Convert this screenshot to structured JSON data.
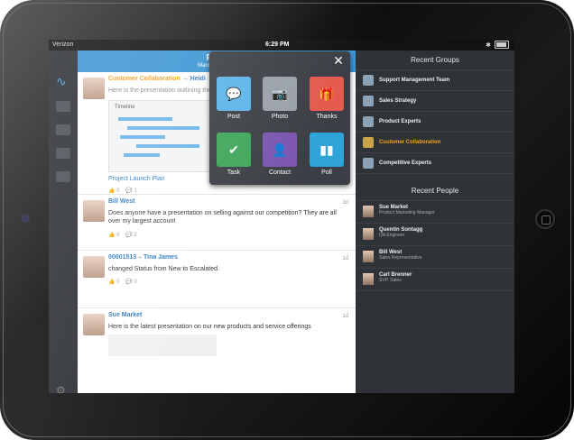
{
  "status_bar": {
    "carrier": "Verizon",
    "time": "6:29 PM"
  },
  "feed": {
    "title": "Feed",
    "date": "March 13, 2013",
    "posts": [
      {
        "author": "Customer Collaboration",
        "arrow": "→",
        "author2": "Heidi",
        "text": "Here is the presentation outlining the...",
        "attachment_title": "Timeline",
        "attachment_link": "Project Launch Plan",
        "likes": "0",
        "comments": "1"
      },
      {
        "author": "Bill West",
        "age": "1d",
        "text": "Does anyone have a presentation on selling against our competition? They are all over my largest account",
        "likes": "0",
        "comments": "2"
      },
      {
        "author": "00001513",
        "arrow": "–",
        "author2": "Tina James",
        "age": "1d",
        "text": "changed Status from New to Escalated.",
        "likes": "0",
        "comments": "0"
      },
      {
        "author": "Sue Market",
        "age": "1d",
        "text": "Here is the latest presentation on our new products and service offerings"
      }
    ]
  },
  "popup": {
    "close": "✕",
    "actions": [
      {
        "label": "Post",
        "icon": "💬",
        "color": "#5cb4e8"
      },
      {
        "label": "Photo",
        "icon": "📷",
        "color": "#9aa0a8"
      },
      {
        "label": "Thanks",
        "icon": "🎁",
        "color": "#e45a4e"
      },
      {
        "label": "Task",
        "icon": "✔",
        "color": "#3fa65a"
      },
      {
        "label": "Contact",
        "icon": "👤",
        "color": "#7b55b0"
      },
      {
        "label": "Poll",
        "icon": "▮▮",
        "color": "#2fa3d8"
      }
    ]
  },
  "recent_groups": {
    "header": "Recent Groups",
    "items": [
      "Support Management Team",
      "Sales Strategy",
      "Product Experts",
      "Customer Collaboration",
      "Competitive Experts"
    ]
  },
  "recent_people": {
    "header": "Recent People",
    "items": [
      {
        "name": "Sue Market",
        "title": "Product Marketing Manager"
      },
      {
        "name": "Quentin Sontagg",
        "title": "QA Engineer"
      },
      {
        "name": "Bill West",
        "title": "Sales Representative"
      },
      {
        "name": "Carl Brenner",
        "title": "SVP, Sales"
      }
    ]
  }
}
